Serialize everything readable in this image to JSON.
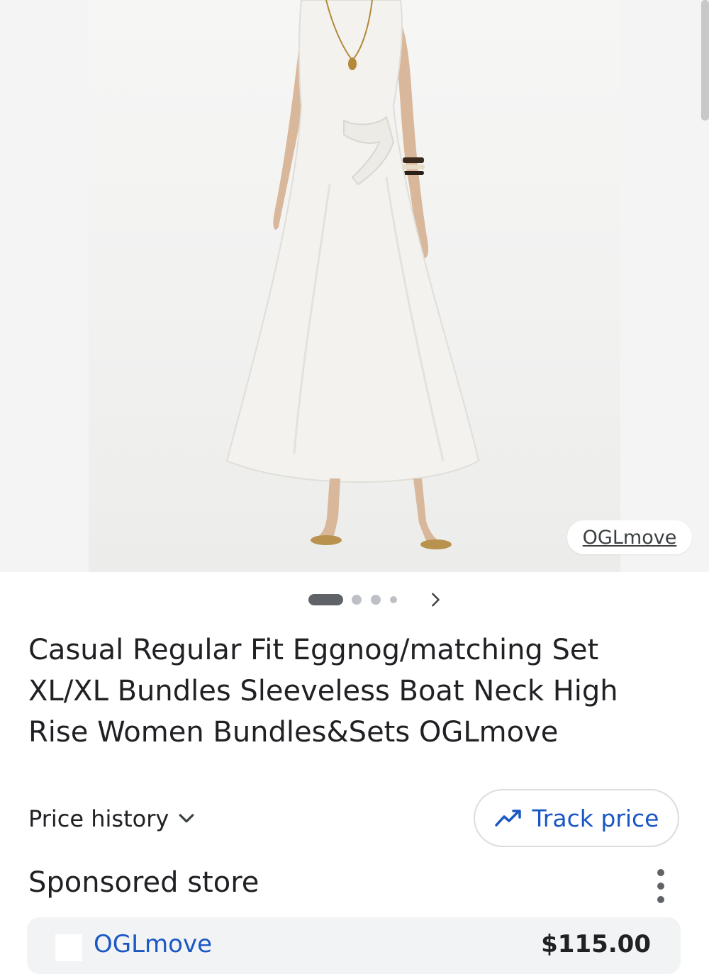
{
  "hero": {
    "source_label": "OGLmove",
    "image_count": 4,
    "active_index": 0
  },
  "product": {
    "title": "Casual Regular Fit Eggnog/matching Set XL/XL Bundles Sleeveless Boat Neck High Rise Women Bundles&Sets OGLmove"
  },
  "price_history": {
    "label": "Price history"
  },
  "track_price": {
    "label": "Track price"
  },
  "sponsored": {
    "heading": "Sponsored store",
    "store": {
      "name": "OGLmove",
      "price": "$115.00"
    }
  },
  "colors": {
    "accent_blue": "#1a56c4",
    "text": "#202124",
    "muted": "#5f6368"
  },
  "icons": {
    "next": "chevron-right-icon",
    "expand": "chevron-down-icon",
    "trend": "trending-up-icon",
    "more": "more-vert-icon"
  }
}
